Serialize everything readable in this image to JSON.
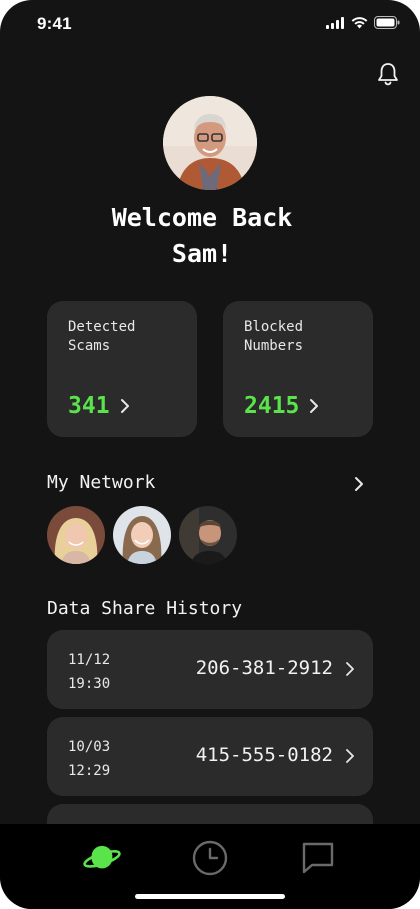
{
  "status_bar": {
    "time": "9:41"
  },
  "profile": {
    "greeting_line1": "Welcome Back",
    "greeting_line2": "Sam!"
  },
  "stats": [
    {
      "label_line1": "Detected",
      "label_line2": "Scams",
      "value": "341"
    },
    {
      "label_line1": "Blocked",
      "label_line2": "Numbers",
      "value": "2415"
    }
  ],
  "network": {
    "title": "My Network"
  },
  "history": {
    "title": "Data Share History",
    "rows": [
      {
        "date": "11/12",
        "time": "19:30",
        "number": "206-381-2912"
      },
      {
        "date": "10/03",
        "time": "12:29",
        "number": "415-555-0182"
      }
    ]
  },
  "tabbar": {
    "items": [
      "planet-icon",
      "clock-icon",
      "chat-icon"
    ],
    "active": "planet-icon"
  },
  "colors": {
    "accent": "#5ae34a",
    "background": "#141414",
    "card": "#2b2b2b",
    "tabbar": "#000000"
  }
}
